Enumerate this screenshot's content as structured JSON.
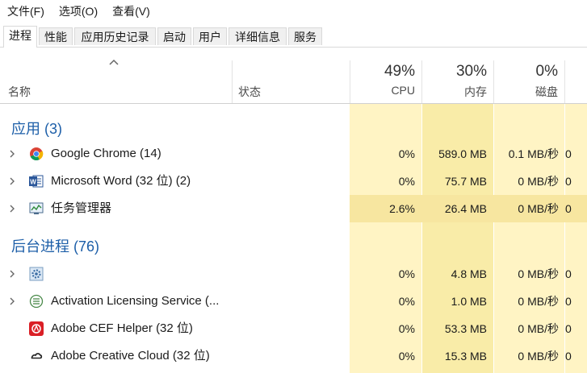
{
  "menu": [
    "文件(F)",
    "选项(O)",
    "查看(V)"
  ],
  "tabs": [
    "进程",
    "性能",
    "应用历史记录",
    "启动",
    "用户",
    "详细信息",
    "服务"
  ],
  "header": {
    "name": "名称",
    "status": "状态",
    "cpu": {
      "pct": "49%",
      "label": "CPU"
    },
    "memory": {
      "pct": "30%",
      "label": "内存"
    },
    "disk": {
      "pct": "0%",
      "label": "磁盘"
    }
  },
  "groups": {
    "apps": "应用 (3)",
    "background": "后台进程 (76)"
  },
  "apps": [
    {
      "name": "Google Chrome (14)",
      "icon": "chrome-icon",
      "cpu": "0%",
      "mem": "589.0 MB",
      "disk": "0.1 MB/秒",
      "net": "0"
    },
    {
      "name": "Microsoft Word (32 位) (2)",
      "icon": "word-icon",
      "cpu": "0%",
      "mem": "75.7 MB",
      "disk": "0 MB/秒",
      "net": "0"
    },
    {
      "name": "任务管理器",
      "icon": "task-manager-icon",
      "cpu": "2.6%",
      "mem": "26.4 MB",
      "disk": "0 MB/秒",
      "net": "0"
    }
  ],
  "background": [
    {
      "name": "",
      "icon": "gear-icon",
      "cpu": "0%",
      "mem": "4.8 MB",
      "disk": "0 MB/秒",
      "net": "0"
    },
    {
      "name": "Activation Licensing Service (...",
      "icon": "service-icon",
      "cpu": "0%",
      "mem": "1.0 MB",
      "disk": "0 MB/秒",
      "net": "0"
    },
    {
      "name": "Adobe CEF Helper (32 位)",
      "icon": "adobe-cef-icon",
      "cpu": "0%",
      "mem": "53.3 MB",
      "disk": "0 MB/秒",
      "net": "0"
    },
    {
      "name": "Adobe Creative Cloud (32 位)",
      "icon": "creative-cloud-icon",
      "cpu": "0%",
      "mem": "15.3 MB",
      "disk": "0 MB/秒",
      "net": "0"
    }
  ],
  "colors": {
    "tint_light": "#fff4c4",
    "tint_dark": "#f9eca8",
    "group": "#1c5ea8"
  }
}
